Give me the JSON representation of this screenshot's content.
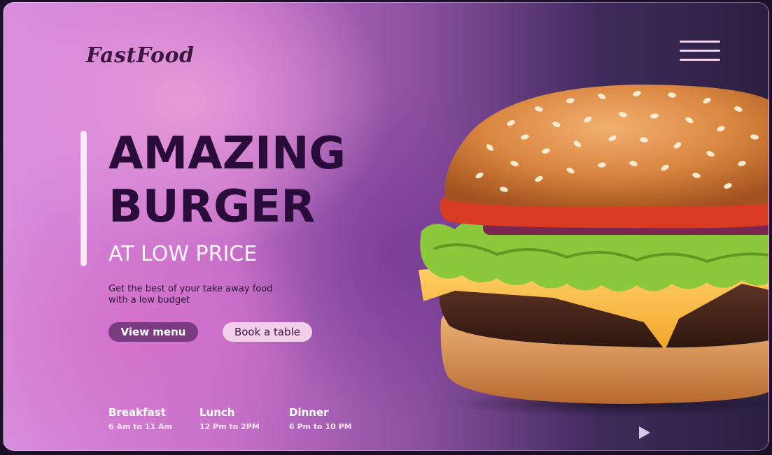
{
  "brand": {
    "logo": "FastFood"
  },
  "hero": {
    "title_line1": "AMAZING",
    "title_line2": "BURGER",
    "subtitle": "AT LOW PRICE",
    "description": "Get the best of your take away food with a low budget"
  },
  "actions": {
    "view_menu": "View menu",
    "book_table": "Book a table"
  },
  "hours": [
    {
      "meal": "Breakfast",
      "time": "6 Am to 11 Am"
    },
    {
      "meal": "Lunch",
      "time": "12 Pm to 2PM"
    },
    {
      "meal": "Dinner",
      "time": "6 Pm to 10 PM"
    }
  ],
  "icons": {
    "menu": "hamburger-menu-icon",
    "play": "play-icon",
    "hero_image": "burger-image"
  },
  "colors": {
    "headline": "#2a0c3a",
    "primary_button": "#7a3b80",
    "secondary_button": "#f2cfe9",
    "accent_bar": "#fbeaf6"
  }
}
